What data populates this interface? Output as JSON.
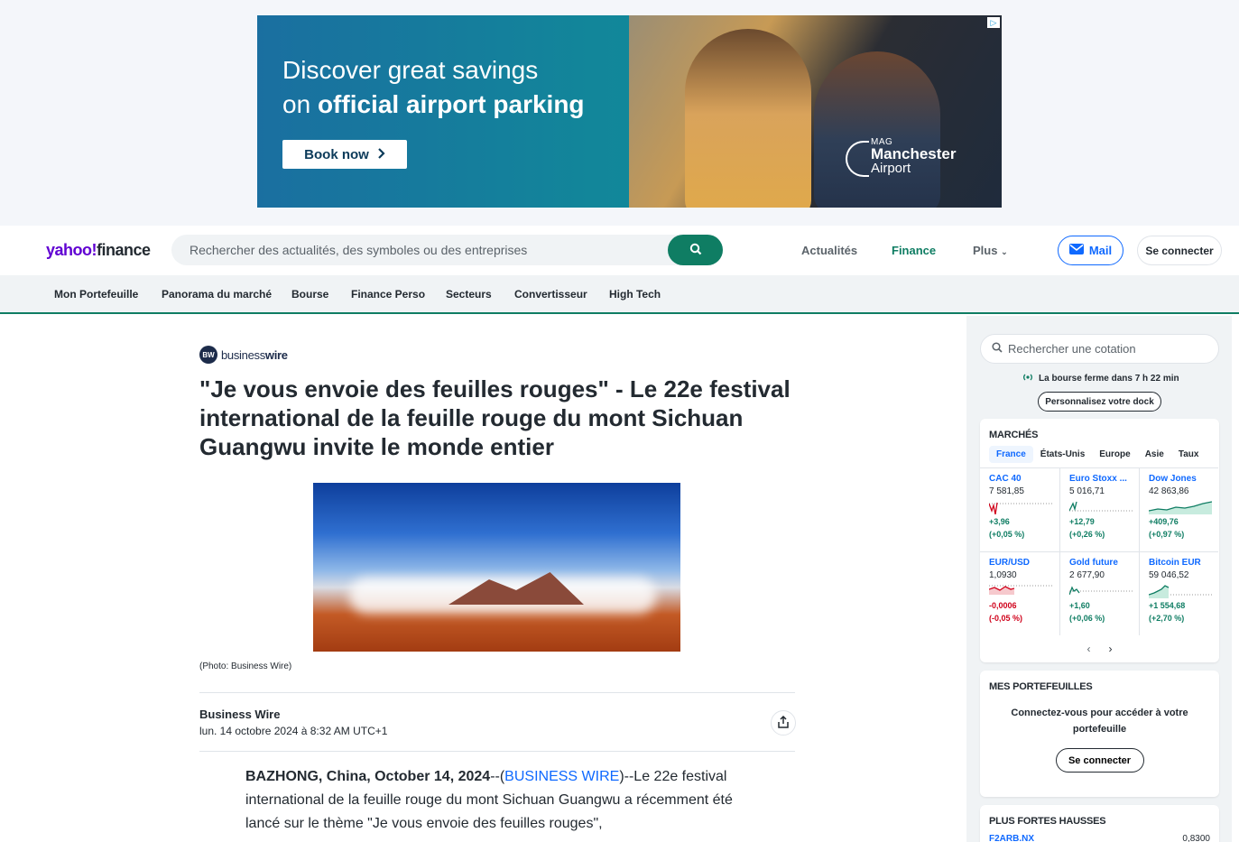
{
  "ad": {
    "line1": "Discover great savings",
    "line2_prefix": "on ",
    "line2_bold": "official airport parking",
    "button": "Book now",
    "logo_small": "MAG",
    "logo_big": "Manchester",
    "logo_mid": "Airport",
    "choice_icon": "ad-choices-icon"
  },
  "header": {
    "logo_yahoo": "yahoo!",
    "logo_finance": "finance",
    "search_placeholder": "Rechercher des actualités, des symboles ou des entreprises",
    "nav": [
      "Actualités",
      "Finance",
      "Plus"
    ],
    "mail": "Mail",
    "login": "Se connecter"
  },
  "subnav": [
    "Mon Portefeuille",
    "Panorama du marché",
    "Bourse",
    "Finance Perso",
    "Secteurs",
    "Convertisseur",
    "High Tech"
  ],
  "article": {
    "source_logo_circle": "BW",
    "source_logo_text": "business",
    "source_logo_bold": "wire",
    "title": "\"Je vous envoie des feuilles rouges\" - Le 22e festival international de la feuille rouge du mont Sichuan Guangwu invite le monde entier",
    "caption": "(Photo: Business Wire)",
    "byline": "Business Wire",
    "date": "lun. 14 octobre 2024 à 8:32 AM UTC+1",
    "dateline": "BAZHONG, China, October 14, 2024",
    "dateline_sep": "--(",
    "wire_link": "BUSINESS WIRE",
    "body": ")--Le 22e festival international de la feuille rouge du mont Sichuan Guangwu a récemment été lancé sur le thème \"Je vous envoie des feuilles rouges\","
  },
  "sidebar": {
    "quote_placeholder": "Rechercher une cotation",
    "market_status": "La bourse ferme dans 7 h 22 min",
    "dock": "Personnalisez votre dock",
    "markets_title": "MARCHÉS",
    "tabs": [
      "France",
      "États-Unis",
      "Europe",
      "Asie",
      "Taux"
    ],
    "quotes": [
      {
        "name": "CAC 40",
        "price": "7 581,85",
        "change": "+3,96",
        "pct": "(+0,05 %)",
        "dir": "up"
      },
      {
        "name": "Euro Stoxx ...",
        "price": "5 016,71",
        "change": "+12,79",
        "pct": "(+0,26 %)",
        "dir": "up"
      },
      {
        "name": "Dow Jones",
        "price": "42 863,86",
        "change": "+409,76",
        "pct": "(+0,97 %)",
        "dir": "up"
      },
      {
        "name": "EUR/USD",
        "price": "1,0930",
        "change": "-0,0006",
        "pct": "(-0,05 %)",
        "dir": "down"
      },
      {
        "name": "Gold future",
        "price": "2 677,90",
        "change": "+1,60",
        "pct": "(+0,06 %)",
        "dir": "up"
      },
      {
        "name": "Bitcoin EUR",
        "price": "59 046,52",
        "change": "+1 554,68",
        "pct": "(+2,70 %)",
        "dir": "up"
      }
    ],
    "portfolio_title": "MES PORTEFEUILLES",
    "portfolio_msg": "Connectez-vous pour accéder à votre portefeuille",
    "portfolio_btn": "Se connecter",
    "gainers_title": "PLUS FORTES HAUSSES",
    "gainer_symbol": "F2ARB.NX",
    "gainer_value": "0,8300"
  }
}
